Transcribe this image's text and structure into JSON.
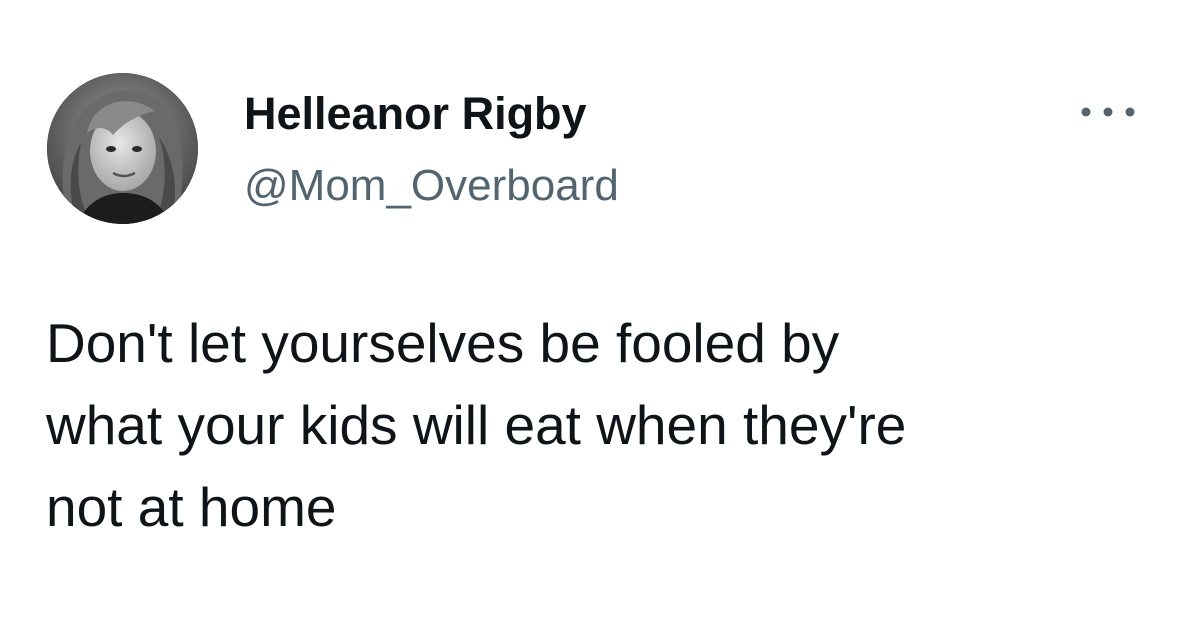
{
  "tweet": {
    "author": {
      "display_name": "Helleanor Rigby",
      "handle": "@Mom_Overboard",
      "avatar_icon": "profile-photo"
    },
    "more_icon": "more-horizontal-icon",
    "text_lines": [
      "Don't let yourselves be fooled by",
      "what your kids will eat when they're",
      "not at home"
    ]
  },
  "colors": {
    "text_primary": "#0f1419",
    "text_secondary": "#536471",
    "background": "#ffffff"
  }
}
